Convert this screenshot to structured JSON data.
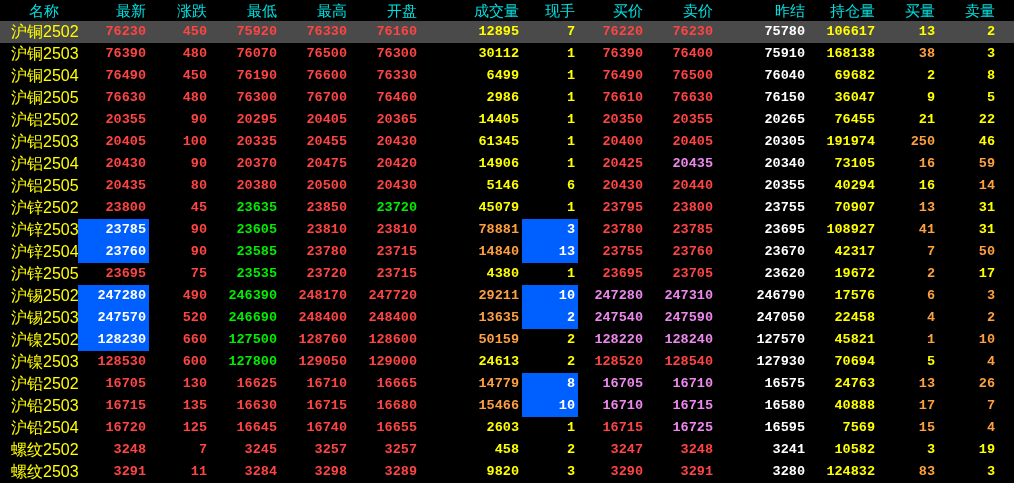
{
  "columns": [
    "名称",
    "最新",
    "涨跌",
    "最低",
    "最高",
    "开盘",
    "成交量",
    "现手",
    "买价",
    "卖价",
    "昨结",
    "持仓量",
    "买量",
    "卖量"
  ],
  "rows": [
    {
      "name": "沪铜2502",
      "selected": true,
      "cells": [
        {
          "text": "76230",
          "color": "#ff4444",
          "highlighted": false
        },
        {
          "text": "450",
          "color": "#ff4444",
          "highlighted": false
        },
        {
          "text": "75920",
          "color": "#ff4444",
          "highlighted": false
        },
        {
          "text": "76330",
          "color": "#ff4444",
          "highlighted": false
        },
        {
          "text": "76160",
          "color": "#ff4444",
          "highlighted": false
        },
        {
          "text": "12895",
          "color": "#ffff00",
          "highlighted": false
        },
        {
          "text": "7",
          "color": "#ffff00",
          "highlighted": false
        },
        {
          "text": "76220",
          "color": "#ff4444",
          "highlighted": false
        },
        {
          "text": "76230",
          "color": "#ff4444",
          "highlighted": false
        },
        {
          "text": "75780",
          "color": "#ffffff",
          "highlighted": false
        },
        {
          "text": "106617",
          "color": "#ffff00",
          "highlighted": false
        },
        {
          "text": "13",
          "color": "#ffff00",
          "highlighted": false
        },
        {
          "text": "2",
          "color": "#ffff00",
          "highlighted": false
        }
      ]
    },
    {
      "name": "沪铜2503",
      "selected": false,
      "cells": [
        {
          "text": "76390",
          "color": "#ff4444",
          "highlighted": false
        },
        {
          "text": "480",
          "color": "#ff4444",
          "highlighted": false
        },
        {
          "text": "76070",
          "color": "#ff4444",
          "highlighted": false
        },
        {
          "text": "76500",
          "color": "#ff4444",
          "highlighted": false
        },
        {
          "text": "76300",
          "color": "#ff4444",
          "highlighted": false
        },
        {
          "text": "30112",
          "color": "#ffff00",
          "highlighted": false
        },
        {
          "text": "1",
          "color": "#ffff00",
          "highlighted": false
        },
        {
          "text": "76390",
          "color": "#ff4444",
          "highlighted": false
        },
        {
          "text": "76400",
          "color": "#ff4444",
          "highlighted": false
        },
        {
          "text": "75910",
          "color": "#ffffff",
          "highlighted": false
        },
        {
          "text": "168138",
          "color": "#ffff00",
          "highlighted": false
        },
        {
          "text": "38",
          "color": "#ffa040",
          "highlighted": false
        },
        {
          "text": "3",
          "color": "#ffff00",
          "highlighted": false
        }
      ]
    },
    {
      "name": "沪铜2504",
      "selected": false,
      "cells": [
        {
          "text": "76490",
          "color": "#ff4444",
          "highlighted": false
        },
        {
          "text": "450",
          "color": "#ff4444",
          "highlighted": false
        },
        {
          "text": "76190",
          "color": "#ff4444",
          "highlighted": false
        },
        {
          "text": "76600",
          "color": "#ff4444",
          "highlighted": false
        },
        {
          "text": "76330",
          "color": "#ff4444",
          "highlighted": false
        },
        {
          "text": "6499",
          "color": "#ffff00",
          "highlighted": false
        },
        {
          "text": "1",
          "color": "#ffff00",
          "highlighted": false
        },
        {
          "text": "76490",
          "color": "#ff4444",
          "highlighted": false
        },
        {
          "text": "76500",
          "color": "#ff4444",
          "highlighted": false
        },
        {
          "text": "76040",
          "color": "#ffffff",
          "highlighted": false
        },
        {
          "text": "69682",
          "color": "#ffff00",
          "highlighted": false
        },
        {
          "text": "2",
          "color": "#ffff00",
          "highlighted": false
        },
        {
          "text": "8",
          "color": "#ffff00",
          "highlighted": false
        }
      ]
    },
    {
      "name": "沪铜2505",
      "selected": false,
      "cells": [
        {
          "text": "76630",
          "color": "#ff4444",
          "highlighted": false
        },
        {
          "text": "480",
          "color": "#ff4444",
          "highlighted": false
        },
        {
          "text": "76300",
          "color": "#ff4444",
          "highlighted": false
        },
        {
          "text": "76700",
          "color": "#ff4444",
          "highlighted": false
        },
        {
          "text": "76460",
          "color": "#ff4444",
          "highlighted": false
        },
        {
          "text": "2986",
          "color": "#ffff00",
          "highlighted": false
        },
        {
          "text": "1",
          "color": "#ffff00",
          "highlighted": false
        },
        {
          "text": "76610",
          "color": "#ff4444",
          "highlighted": false
        },
        {
          "text": "76630",
          "color": "#ff4444",
          "highlighted": false
        },
        {
          "text": "76150",
          "color": "#ffffff",
          "highlighted": false
        },
        {
          "text": "36047",
          "color": "#ffff00",
          "highlighted": false
        },
        {
          "text": "9",
          "color": "#ffff00",
          "highlighted": false
        },
        {
          "text": "5",
          "color": "#ffff00",
          "highlighted": false
        }
      ]
    },
    {
      "name": "沪铝2502",
      "selected": false,
      "cells": [
        {
          "text": "20355",
          "color": "#ff4444",
          "highlighted": false
        },
        {
          "text": "90",
          "color": "#ff4444",
          "highlighted": false
        },
        {
          "text": "20295",
          "color": "#ff4444",
          "highlighted": false
        },
        {
          "text": "20405",
          "color": "#ff4444",
          "highlighted": false
        },
        {
          "text": "20365",
          "color": "#ff4444",
          "highlighted": false
        },
        {
          "text": "14405",
          "color": "#ffff00",
          "highlighted": false
        },
        {
          "text": "1",
          "color": "#ffff00",
          "highlighted": false
        },
        {
          "text": "20350",
          "color": "#ff4444",
          "highlighted": false
        },
        {
          "text": "20355",
          "color": "#ff4444",
          "highlighted": false
        },
        {
          "text": "20265",
          "color": "#ffffff",
          "highlighted": false
        },
        {
          "text": "76455",
          "color": "#ffff00",
          "highlighted": false
        },
        {
          "text": "21",
          "color": "#ffff00",
          "highlighted": false
        },
        {
          "text": "22",
          "color": "#ffff00",
          "highlighted": false
        }
      ]
    },
    {
      "name": "沪铝2503",
      "selected": false,
      "cells": [
        {
          "text": "20405",
          "color": "#ff4444",
          "highlighted": false
        },
        {
          "text": "100",
          "color": "#ff4444",
          "highlighted": false
        },
        {
          "text": "20335",
          "color": "#ff4444",
          "highlighted": false
        },
        {
          "text": "20455",
          "color": "#ff4444",
          "highlighted": false
        },
        {
          "text": "20430",
          "color": "#ff4444",
          "highlighted": false
        },
        {
          "text": "61345",
          "color": "#ffff00",
          "highlighted": false
        },
        {
          "text": "1",
          "color": "#ffff00",
          "highlighted": false
        },
        {
          "text": "20400",
          "color": "#ff4444",
          "highlighted": false
        },
        {
          "text": "20405",
          "color": "#ff4444",
          "highlighted": false
        },
        {
          "text": "20305",
          "color": "#ffffff",
          "highlighted": false
        },
        {
          "text": "191974",
          "color": "#ffff00",
          "highlighted": false
        },
        {
          "text": "250",
          "color": "#ffa040",
          "highlighted": false
        },
        {
          "text": "46",
          "color": "#ffff00",
          "highlighted": false
        }
      ]
    },
    {
      "name": "沪铝2504",
      "selected": false,
      "cells": [
        {
          "text": "20430",
          "color": "#ff4444",
          "highlighted": false
        },
        {
          "text": "90",
          "color": "#ff4444",
          "highlighted": false
        },
        {
          "text": "20370",
          "color": "#ff4444",
          "highlighted": false
        },
        {
          "text": "20475",
          "color": "#ff4444",
          "highlighted": false
        },
        {
          "text": "20420",
          "color": "#ff4444",
          "highlighted": false
        },
        {
          "text": "14906",
          "color": "#ffff00",
          "highlighted": false
        },
        {
          "text": "1",
          "color": "#ffff00",
          "highlighted": false
        },
        {
          "text": "20425",
          "color": "#ff4444",
          "highlighted": false
        },
        {
          "text": "20435",
          "color": "#ee88ee",
          "highlighted": false
        },
        {
          "text": "20340",
          "color": "#ffffff",
          "highlighted": false
        },
        {
          "text": "73105",
          "color": "#ffff00",
          "highlighted": false
        },
        {
          "text": "16",
          "color": "#ffa040",
          "highlighted": false
        },
        {
          "text": "59",
          "color": "#ffa040",
          "highlighted": false
        }
      ]
    },
    {
      "name": "沪铝2505",
      "selected": false,
      "cells": [
        {
          "text": "20435",
          "color": "#ff4444",
          "highlighted": false
        },
        {
          "text": "80",
          "color": "#ff4444",
          "highlighted": false
        },
        {
          "text": "20380",
          "color": "#ff4444",
          "highlighted": false
        },
        {
          "text": "20500",
          "color": "#ff4444",
          "highlighted": false
        },
        {
          "text": "20430",
          "color": "#ff4444",
          "highlighted": false
        },
        {
          "text": "5146",
          "color": "#ffff00",
          "highlighted": false
        },
        {
          "text": "6",
          "color": "#ffff00",
          "highlighted": false
        },
        {
          "text": "20430",
          "color": "#ff4444",
          "highlighted": false
        },
        {
          "text": "20440",
          "color": "#ff4444",
          "highlighted": false
        },
        {
          "text": "20355",
          "color": "#ffffff",
          "highlighted": false
        },
        {
          "text": "40294",
          "color": "#ffff00",
          "highlighted": false
        },
        {
          "text": "16",
          "color": "#ffff00",
          "highlighted": false
        },
        {
          "text": "14",
          "color": "#ffa040",
          "highlighted": false
        }
      ]
    },
    {
      "name": "沪锌2502",
      "selected": false,
      "cells": [
        {
          "text": "23800",
          "color": "#ff4444",
          "highlighted": false
        },
        {
          "text": "45",
          "color": "#ff4444",
          "highlighted": false
        },
        {
          "text": "23635",
          "color": "#00ee00",
          "highlighted": false
        },
        {
          "text": "23850",
          "color": "#ff4444",
          "highlighted": false
        },
        {
          "text": "23720",
          "color": "#00ee00",
          "highlighted": false
        },
        {
          "text": "45079",
          "color": "#ffff00",
          "highlighted": false
        },
        {
          "text": "1",
          "color": "#ffff00",
          "highlighted": false
        },
        {
          "text": "23795",
          "color": "#ff4444",
          "highlighted": false
        },
        {
          "text": "23800",
          "color": "#ff4444",
          "highlighted": false
        },
        {
          "text": "23755",
          "color": "#ffffff",
          "highlighted": false
        },
        {
          "text": "70907",
          "color": "#ffff00",
          "highlighted": false
        },
        {
          "text": "13",
          "color": "#ffa040",
          "highlighted": false
        },
        {
          "text": "31",
          "color": "#ffff00",
          "highlighted": false
        }
      ]
    },
    {
      "name": "沪锌2503",
      "selected": false,
      "cells": [
        {
          "text": "23785",
          "color": "#ffffff",
          "highlighted": true
        },
        {
          "text": "90",
          "color": "#ff4444",
          "highlighted": false
        },
        {
          "text": "23605",
          "color": "#00ee00",
          "highlighted": false
        },
        {
          "text": "23810",
          "color": "#ff4444",
          "highlighted": false
        },
        {
          "text": "23810",
          "color": "#ff4444",
          "highlighted": false
        },
        {
          "text": "78881",
          "color": "#ffa040",
          "highlighted": false
        },
        {
          "text": "3",
          "color": "#ffffff",
          "highlighted": true
        },
        {
          "text": "23780",
          "color": "#ff4444",
          "highlighted": false
        },
        {
          "text": "23785",
          "color": "#ff4444",
          "highlighted": false
        },
        {
          "text": "23695",
          "color": "#ffffff",
          "highlighted": false
        },
        {
          "text": "108927",
          "color": "#ffff00",
          "highlighted": false
        },
        {
          "text": "41",
          "color": "#ffa040",
          "highlighted": false
        },
        {
          "text": "31",
          "color": "#ffff00",
          "highlighted": false
        }
      ]
    },
    {
      "name": "沪锌2504",
      "selected": false,
      "cells": [
        {
          "text": "23760",
          "color": "#ffffff",
          "highlighted": true
        },
        {
          "text": "90",
          "color": "#ff4444",
          "highlighted": false
        },
        {
          "text": "23585",
          "color": "#00ee00",
          "highlighted": false
        },
        {
          "text": "23780",
          "color": "#ff4444",
          "highlighted": false
        },
        {
          "text": "23715",
          "color": "#ff4444",
          "highlighted": false
        },
        {
          "text": "14840",
          "color": "#ffa040",
          "highlighted": false
        },
        {
          "text": "13",
          "color": "#ffffff",
          "highlighted": true
        },
        {
          "text": "23755",
          "color": "#ff4444",
          "highlighted": false
        },
        {
          "text": "23760",
          "color": "#ff4444",
          "highlighted": false
        },
        {
          "text": "23670",
          "color": "#ffffff",
          "highlighted": false
        },
        {
          "text": "42317",
          "color": "#ffff00",
          "highlighted": false
        },
        {
          "text": "7",
          "color": "#ffa040",
          "highlighted": false
        },
        {
          "text": "50",
          "color": "#ffa040",
          "highlighted": false
        }
      ]
    },
    {
      "name": "沪锌2505",
      "selected": false,
      "cells": [
        {
          "text": "23695",
          "color": "#ff4444",
          "highlighted": false
        },
        {
          "text": "75",
          "color": "#ff4444",
          "highlighted": false
        },
        {
          "text": "23535",
          "color": "#00ee00",
          "highlighted": false
        },
        {
          "text": "23720",
          "color": "#ff4444",
          "highlighted": false
        },
        {
          "text": "23715",
          "color": "#ff4444",
          "highlighted": false
        },
        {
          "text": "4380",
          "color": "#ffff00",
          "highlighted": false
        },
        {
          "text": "1",
          "color": "#ffff00",
          "highlighted": false
        },
        {
          "text": "23695",
          "color": "#ff4444",
          "highlighted": false
        },
        {
          "text": "23705",
          "color": "#ff4444",
          "highlighted": false
        },
        {
          "text": "23620",
          "color": "#ffffff",
          "highlighted": false
        },
        {
          "text": "19672",
          "color": "#ffff00",
          "highlighted": false
        },
        {
          "text": "2",
          "color": "#ffa040",
          "highlighted": false
        },
        {
          "text": "17",
          "color": "#ffff00",
          "highlighted": false
        }
      ]
    },
    {
      "name": "沪锡2502",
      "selected": false,
      "cells": [
        {
          "text": "247280",
          "color": "#ffffff",
          "highlighted": true
        },
        {
          "text": "490",
          "color": "#ff4444",
          "highlighted": false
        },
        {
          "text": "246390",
          "color": "#00ee00",
          "highlighted": false
        },
        {
          "text": "248170",
          "color": "#ff4444",
          "highlighted": false
        },
        {
          "text": "247720",
          "color": "#ff4444",
          "highlighted": false
        },
        {
          "text": "29211",
          "color": "#ffa040",
          "highlighted": false
        },
        {
          "text": "10",
          "color": "#ffffff",
          "highlighted": true
        },
        {
          "text": "247280",
          "color": "#ee88ee",
          "highlighted": false
        },
        {
          "text": "247310",
          "color": "#ee88ee",
          "highlighted": false
        },
        {
          "text": "246790",
          "color": "#ffffff",
          "highlighted": false
        },
        {
          "text": "17576",
          "color": "#ffff00",
          "highlighted": false
        },
        {
          "text": "6",
          "color": "#ffa040",
          "highlighted": false
        },
        {
          "text": "3",
          "color": "#ffa040",
          "highlighted": false
        }
      ]
    },
    {
      "name": "沪锡2503",
      "selected": false,
      "cells": [
        {
          "text": "247570",
          "color": "#ffffff",
          "highlighted": true
        },
        {
          "text": "520",
          "color": "#ff4444",
          "highlighted": false
        },
        {
          "text": "246690",
          "color": "#00ee00",
          "highlighted": false
        },
        {
          "text": "248400",
          "color": "#ff4444",
          "highlighted": false
        },
        {
          "text": "248400",
          "color": "#ff4444",
          "highlighted": false
        },
        {
          "text": "13635",
          "color": "#ffa040",
          "highlighted": false
        },
        {
          "text": "2",
          "color": "#ffffff",
          "highlighted": true
        },
        {
          "text": "247540",
          "color": "#ee88ee",
          "highlighted": false
        },
        {
          "text": "247590",
          "color": "#ee88ee",
          "highlighted": false
        },
        {
          "text": "247050",
          "color": "#ffffff",
          "highlighted": false
        },
        {
          "text": "22458",
          "color": "#ffff00",
          "highlighted": false
        },
        {
          "text": "4",
          "color": "#ffa040",
          "highlighted": false
        },
        {
          "text": "2",
          "color": "#ffa040",
          "highlighted": false
        }
      ]
    },
    {
      "name": "沪镍2502",
      "selected": false,
      "cells": [
        {
          "text": "128230",
          "color": "#ffffff",
          "highlighted": true
        },
        {
          "text": "660",
          "color": "#ff4444",
          "highlighted": false
        },
        {
          "text": "127500",
          "color": "#00ee00",
          "highlighted": false
        },
        {
          "text": "128760",
          "color": "#ff4444",
          "highlighted": false
        },
        {
          "text": "128600",
          "color": "#ff4444",
          "highlighted": false
        },
        {
          "text": "50159",
          "color": "#ffa040",
          "highlighted": false
        },
        {
          "text": "2",
          "color": "#ffff00",
          "highlighted": false
        },
        {
          "text": "128220",
          "color": "#ee88ee",
          "highlighted": false
        },
        {
          "text": "128240",
          "color": "#ee88ee",
          "highlighted": false
        },
        {
          "text": "127570",
          "color": "#ffffff",
          "highlighted": false
        },
        {
          "text": "45821",
          "color": "#ffff00",
          "highlighted": false
        },
        {
          "text": "1",
          "color": "#ffa040",
          "highlighted": false
        },
        {
          "text": "10",
          "color": "#ffa040",
          "highlighted": false
        }
      ]
    },
    {
      "name": "沪镍2503",
      "selected": false,
      "cells": [
        {
          "text": "128530",
          "color": "#ff4444",
          "highlighted": false
        },
        {
          "text": "600",
          "color": "#ff4444",
          "highlighted": false
        },
        {
          "text": "127800",
          "color": "#00ee00",
          "highlighted": false
        },
        {
          "text": "129050",
          "color": "#ff4444",
          "highlighted": false
        },
        {
          "text": "129000",
          "color": "#ff4444",
          "highlighted": false
        },
        {
          "text": "24613",
          "color": "#ffff00",
          "highlighted": false
        },
        {
          "text": "2",
          "color": "#ffff00",
          "highlighted": false
        },
        {
          "text": "128520",
          "color": "#ff4444",
          "highlighted": false
        },
        {
          "text": "128540",
          "color": "#ff4444",
          "highlighted": false
        },
        {
          "text": "127930",
          "color": "#ffffff",
          "highlighted": false
        },
        {
          "text": "70694",
          "color": "#ffff00",
          "highlighted": false
        },
        {
          "text": "5",
          "color": "#ffff00",
          "highlighted": false
        },
        {
          "text": "4",
          "color": "#ffa040",
          "highlighted": false
        }
      ]
    },
    {
      "name": "沪铅2502",
      "selected": false,
      "cells": [
        {
          "text": "16705",
          "color": "#ff4444",
          "highlighted": false
        },
        {
          "text": "130",
          "color": "#ff4444",
          "highlighted": false
        },
        {
          "text": "16625",
          "color": "#ff4444",
          "highlighted": false
        },
        {
          "text": "16710",
          "color": "#ff4444",
          "highlighted": false
        },
        {
          "text": "16665",
          "color": "#ff4444",
          "highlighted": false
        },
        {
          "text": "14779",
          "color": "#ffa040",
          "highlighted": false
        },
        {
          "text": "8",
          "color": "#ffffff",
          "highlighted": true
        },
        {
          "text": "16705",
          "color": "#ee88ee",
          "highlighted": false
        },
        {
          "text": "16710",
          "color": "#ee88ee",
          "highlighted": false
        },
        {
          "text": "16575",
          "color": "#ffffff",
          "highlighted": false
        },
        {
          "text": "24763",
          "color": "#ffff00",
          "highlighted": false
        },
        {
          "text": "13",
          "color": "#ffa040",
          "highlighted": false
        },
        {
          "text": "26",
          "color": "#ffa040",
          "highlighted": false
        }
      ]
    },
    {
      "name": "沪铅2503",
      "selected": false,
      "cells": [
        {
          "text": "16715",
          "color": "#ff4444",
          "highlighted": false
        },
        {
          "text": "135",
          "color": "#ff4444",
          "highlighted": false
        },
        {
          "text": "16630",
          "color": "#ff4444",
          "highlighted": false
        },
        {
          "text": "16715",
          "color": "#ff4444",
          "highlighted": false
        },
        {
          "text": "16680",
          "color": "#ff4444",
          "highlighted": false
        },
        {
          "text": "15466",
          "color": "#ffa040",
          "highlighted": false
        },
        {
          "text": "10",
          "color": "#ffffff",
          "highlighted": true
        },
        {
          "text": "16710",
          "color": "#ee88ee",
          "highlighted": false
        },
        {
          "text": "16715",
          "color": "#ee88ee",
          "highlighted": false
        },
        {
          "text": "16580",
          "color": "#ffffff",
          "highlighted": false
        },
        {
          "text": "40888",
          "color": "#ffff00",
          "highlighted": false
        },
        {
          "text": "17",
          "color": "#ffa040",
          "highlighted": false
        },
        {
          "text": "7",
          "color": "#ffa040",
          "highlighted": false
        }
      ]
    },
    {
      "name": "沪铅2504",
      "selected": false,
      "cells": [
        {
          "text": "16720",
          "color": "#ff4444",
          "highlighted": false
        },
        {
          "text": "125",
          "color": "#ff4444",
          "highlighted": false
        },
        {
          "text": "16645",
          "color": "#ff4444",
          "highlighted": false
        },
        {
          "text": "16740",
          "color": "#ff4444",
          "highlighted": false
        },
        {
          "text": "16655",
          "color": "#ff4444",
          "highlighted": false
        },
        {
          "text": "2603",
          "color": "#ffff00",
          "highlighted": false
        },
        {
          "text": "1",
          "color": "#ffff00",
          "highlighted": false
        },
        {
          "text": "16715",
          "color": "#ff4444",
          "highlighted": false
        },
        {
          "text": "16725",
          "color": "#ee88ee",
          "highlighted": false
        },
        {
          "text": "16595",
          "color": "#ffffff",
          "highlighted": false
        },
        {
          "text": "7569",
          "color": "#ffff00",
          "highlighted": false
        },
        {
          "text": "15",
          "color": "#ffa040",
          "highlighted": false
        },
        {
          "text": "4",
          "color": "#ffa040",
          "highlighted": false
        }
      ]
    },
    {
      "name": "螺纹2502",
      "selected": false,
      "cells": [
        {
          "text": "3248",
          "color": "#ff4444",
          "highlighted": false
        },
        {
          "text": "7",
          "color": "#ff4444",
          "highlighted": false
        },
        {
          "text": "3245",
          "color": "#ff4444",
          "highlighted": false
        },
        {
          "text": "3257",
          "color": "#ff4444",
          "highlighted": false
        },
        {
          "text": "3257",
          "color": "#ff4444",
          "highlighted": false
        },
        {
          "text": "458",
          "color": "#ffff00",
          "highlighted": false
        },
        {
          "text": "2",
          "color": "#ffff00",
          "highlighted": false
        },
        {
          "text": "3247",
          "color": "#ff4444",
          "highlighted": false
        },
        {
          "text": "3248",
          "color": "#ff4444",
          "highlighted": false
        },
        {
          "text": "3241",
          "color": "#ffffff",
          "highlighted": false
        },
        {
          "text": "10582",
          "color": "#ffff00",
          "highlighted": false
        },
        {
          "text": "3",
          "color": "#ffff00",
          "highlighted": false
        },
        {
          "text": "19",
          "color": "#ffff00",
          "highlighted": false
        }
      ]
    },
    {
      "name": "螺纹2503",
      "selected": false,
      "cells": [
        {
          "text": "3291",
          "color": "#ff4444",
          "highlighted": false
        },
        {
          "text": "11",
          "color": "#ff4444",
          "highlighted": false
        },
        {
          "text": "3284",
          "color": "#ff4444",
          "highlighted": false
        },
        {
          "text": "3298",
          "color": "#ff4444",
          "highlighted": false
        },
        {
          "text": "3289",
          "color": "#ff4444",
          "highlighted": false
        },
        {
          "text": "9820",
          "color": "#ffff00",
          "highlighted": false
        },
        {
          "text": "3",
          "color": "#ffff00",
          "highlighted": false
        },
        {
          "text": "3290",
          "color": "#ff4444",
          "highlighted": false
        },
        {
          "text": "3291",
          "color": "#ff4444",
          "highlighted": false
        },
        {
          "text": "3280",
          "color": "#ffffff",
          "highlighted": false
        },
        {
          "text": "124832",
          "color": "#ffff00",
          "highlighted": false
        },
        {
          "text": "83",
          "color": "#ffa040",
          "highlighted": false
        },
        {
          "text": "3",
          "color": "#ffff00",
          "highlighted": false
        }
      ]
    }
  ]
}
